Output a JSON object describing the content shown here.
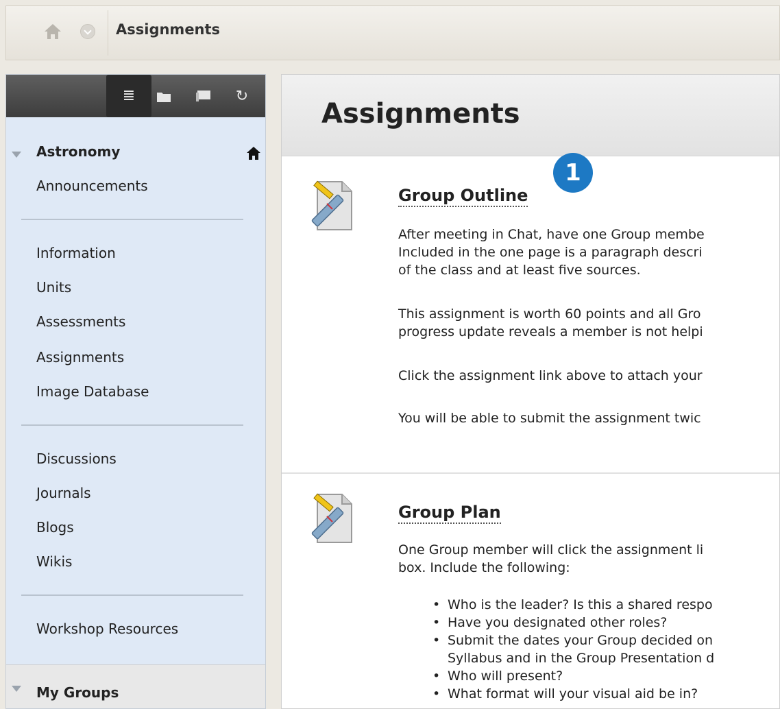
{
  "breadcrumb": {
    "label": "Assignments"
  },
  "sidebar": {
    "toolbar": [
      "list-view",
      "folder-view",
      "chat",
      "refresh"
    ],
    "course_title": "Astronomy",
    "group1": [
      "Announcements"
    ],
    "group2": [
      "Information",
      "Units",
      "Assessments",
      "Assignments",
      "Image Database"
    ],
    "group3": [
      "Discussions",
      "Journals",
      "Blogs",
      "Wikis"
    ],
    "group4": [
      "Workshop Resources"
    ],
    "my_groups": "My Groups"
  },
  "main": {
    "title": "Assignments",
    "badge": "1",
    "items": [
      {
        "title": "Group Outline",
        "lines": [
          "After meeting in Chat, have one Group membe",
          "Included in the one page is a paragraph descri",
          "of the class and at least five sources.",
          "This assignment is worth 60 points and all Gro",
          "progress update reveals a member is not helpi",
          "Click the assignment link above to attach your",
          "You will be able to submit the assignment twic"
        ]
      },
      {
        "title": "Group Plan",
        "lines": [
          "One Group member will click the assignment li",
          "box. Include the following:"
        ],
        "bullets": [
          "Who is the leader? Is this a shared respo",
          "Have you designated other roles?",
          "Submit the dates your Group decided on",
          "Syllabus and in the Group Presentation d",
          "Who will present?",
          "What format will your visual aid be in?"
        ]
      }
    ]
  },
  "colors": {
    "badge": "#1d79c4",
    "sidebar_bg": "#dfe9f6",
    "toolbar_bg": "#4a4a4a"
  }
}
